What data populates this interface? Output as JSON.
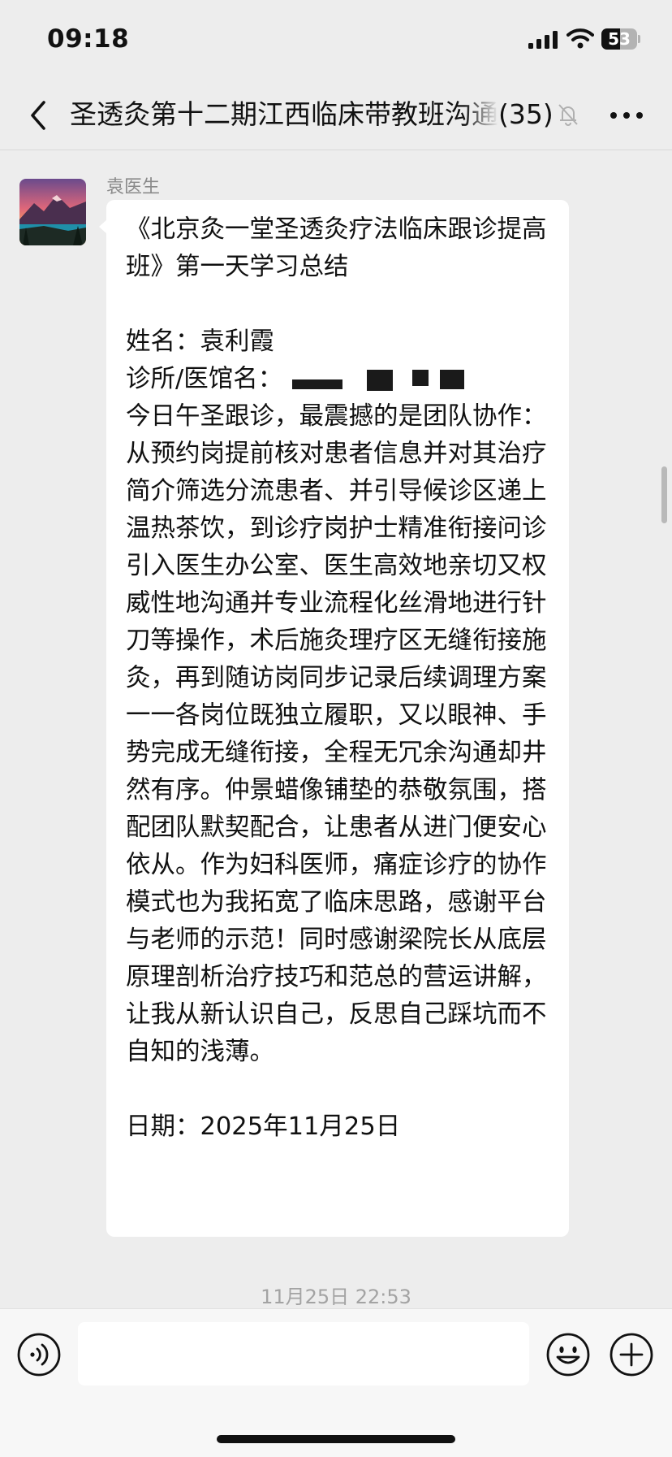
{
  "status_bar": {
    "time": "09:18",
    "battery_level": "53",
    "battery_percent": 53
  },
  "nav": {
    "title": "圣透灸第十二期江西临床带教班沟通",
    "member_count": "(35)",
    "icons": [
      "chevron-left-icon",
      "bell-muted-icon",
      "more-dots-icon"
    ]
  },
  "message": {
    "sender": "袁医生",
    "lines": [
      "《北京灸一堂圣透灸疗法临床跟诊提高班》第一天学习总结",
      "",
      "姓名：袁利霞",
      "诊所/医馆名：",
      "今日午圣跟诊，最震撼的是团队协作：从预约岗提前核对患者信息并对其治疗简介筛选分流患者、并引导候诊区递上温热茶饮，到诊疗岗护士精准衔接问诊引入医生办公室、医生高效地亲切又权威性地沟通并专业流程化丝滑地进行针刀等操作，术后施灸理疗区无缝衔接施灸，再到随访岗同步记录后续调理方案一一各岗位既独立履职，又以眼神、手势完成无缝衔接，全程无冗余沟通却井然有序。仲景蜡像铺垫的恭敬氛围，搭配团队默契配合，让患者从进门便安心依从。作为妇科医师，痛症诊疗的协作模式也为我拓宽了临床思路，感谢平台与老师的示范！同时感谢梁院长从底层原理剖析治疗技巧和范总的营运讲解，让我从新认识自己，反思自己踩坑而不自知的浅薄。",
      "",
      "日期：2025年11月25日"
    ]
  },
  "timestamp": "11月25日 22:53",
  "input": {
    "value": "",
    "icons": [
      "voice-icon",
      "emoji-icon",
      "plus-icon"
    ]
  },
  "colors": {
    "background": "#ededed",
    "bubble": "#ffffff",
    "text": "#111111",
    "meta_text": "#a3a3a3"
  }
}
